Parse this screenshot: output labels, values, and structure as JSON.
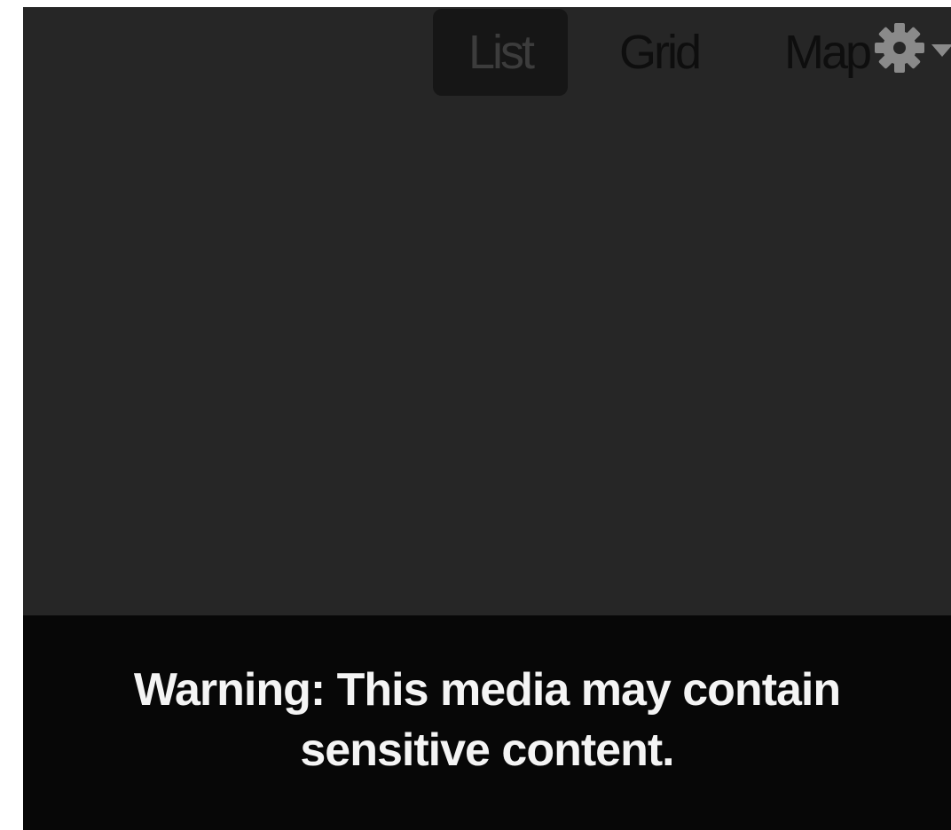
{
  "view_tabs": {
    "list_label": "List",
    "grid_label": "Grid",
    "map_label": "Map",
    "active": "List"
  },
  "settings": {
    "icon": "gear-icon",
    "caret": "caret-down-icon"
  },
  "media_warning": {
    "text": "Warning: This media may contain sensitive content."
  },
  "colors": {
    "background": "#262626",
    "active_tab_background": "#161616",
    "warning_bar": "#070707",
    "warning_text": "#f4f4f4",
    "gear": "#8a8a8a"
  }
}
